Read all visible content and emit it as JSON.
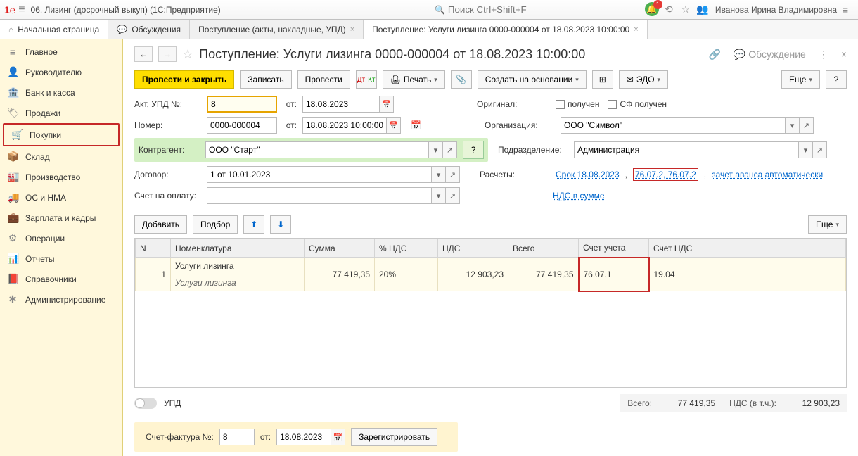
{
  "titlebar": {
    "app_title": "06. Лизинг (досрочный выкуп)  (1С:Предприятие)",
    "search_placeholder": "Поиск Ctrl+Shift+F",
    "user": "Иванова Ирина Владимировна",
    "bell_count": "1"
  },
  "tabs": {
    "home": "Начальная страница",
    "t1": "Обсуждения",
    "t2": "Поступление (акты, накладные, УПД)",
    "t3": "Поступление: Услуги лизинга 0000-000004 от 18.08.2023 10:00:00"
  },
  "sidebar": {
    "items": [
      {
        "icon": "≡",
        "label": "Главное"
      },
      {
        "icon": "👤",
        "label": "Руководителю"
      },
      {
        "icon": "🏦",
        "label": "Банк и касса"
      },
      {
        "icon": "🏷",
        "label": "Продажи"
      },
      {
        "icon": "🛒",
        "label": "Покупки"
      },
      {
        "icon": "📦",
        "label": "Склад"
      },
      {
        "icon": "🏭",
        "label": "Производство"
      },
      {
        "icon": "🚚",
        "label": "ОС и НМА"
      },
      {
        "icon": "💼",
        "label": "Зарплата и кадры"
      },
      {
        "icon": "⚙",
        "label": "Операции"
      },
      {
        "icon": "📊",
        "label": "Отчеты"
      },
      {
        "icon": "📕",
        "label": "Справочники"
      },
      {
        "icon": "✱",
        "label": "Администрирование"
      }
    ],
    "active_index": 4
  },
  "doc": {
    "title": "Поступление: Услуги лизинга 0000-000004 от 18.08.2023 10:00:00",
    "discussion": "Обсуждение"
  },
  "toolbar": {
    "post_close": "Провести и закрыть",
    "save": "Записать",
    "post": "Провести",
    "print": "Печать",
    "create_based": "Создать на основании",
    "edo": "ЭДО",
    "more": "Еще",
    "help": "?"
  },
  "form": {
    "act_lbl": "Акт, УПД №:",
    "act_no": "8",
    "ot": "от:",
    "act_date": "18.08.2023",
    "number_lbl": "Номер:",
    "number": "0000-000004",
    "number_date": "18.08.2023 10:00:00",
    "contragent_lbl": "Контрагент:",
    "contragent": "ООО \"Старт\"",
    "contract_lbl": "Договор:",
    "contract": "1 от 10.01.2023",
    "invoice_pay_lbl": "Счет на оплату:",
    "invoice_pay": "",
    "original_lbl": "Оригинал:",
    "received": "получен",
    "sf_received": "СФ получен",
    "org_lbl": "Организация:",
    "org": "ООО \"Символ\"",
    "dept_lbl": "Подразделение:",
    "dept": "Администрация",
    "calc_lbl": "Расчеты:",
    "calc_link1": "Срок 18.08.2023",
    "calc_link2": "76.07.2, 76.07.2",
    "calc_link3": "зачет аванса автоматически",
    "nds_link": "НДС в сумме"
  },
  "toolbar2": {
    "add": "Добавить",
    "select": "Подбор",
    "more": "Еще"
  },
  "table": {
    "headers": [
      "N",
      "Номенклатура",
      "Сумма",
      "% НДС",
      "НДС",
      "Всего",
      "Счет учета",
      "Счет НДС"
    ],
    "rows": [
      {
        "n": "1",
        "nomen": "Услуги лизинга",
        "nomen_sub": "Услуги лизинга",
        "sum": "77 419,35",
        "pct": "20%",
        "nds": "12 903,23",
        "total": "77 419,35",
        "acct": "76.07.1",
        "acct_nds": "19.04"
      }
    ]
  },
  "footer": {
    "upd": "УПД",
    "total_lbl": "Всего:",
    "total_val": "77 419,35",
    "nds_lbl": "НДС (в т.ч.):",
    "nds_val": "12 903,23",
    "sf_lbl": "Счет-фактура №:",
    "sf_no": "8",
    "sf_ot": "от:",
    "sf_date": "18.08.2023",
    "register": "Зарегистрировать"
  }
}
